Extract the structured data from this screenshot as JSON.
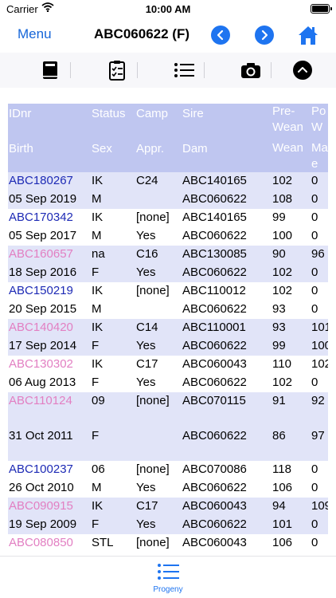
{
  "status_bar": {
    "carrier": "Carrier",
    "time": "10:00 AM"
  },
  "nav": {
    "menu_label": "Menu",
    "title": "ABC060622 (F)"
  },
  "tab_bar": {
    "label": "Progeny"
  },
  "colors": {
    "accent": "#1e74f0",
    "male_id": "#1d2ab5",
    "female_id": "#e27fc2",
    "header_bg": "#bfc6f0",
    "row_band": "#e1e4f8"
  },
  "table": {
    "header": [
      {
        "id": "IDnr",
        "status": "Status",
        "camp": "Camp",
        "sire": "Sire",
        "pre": "Pre-\nWean",
        "po": "Po\nW"
      },
      {
        "id": "Birth",
        "status": "Sex",
        "camp": "Appr.",
        "sire": "Dam",
        "pre": "Wean",
        "po": "Ma\ne"
      }
    ],
    "records": [
      {
        "gender": "male",
        "a": {
          "id": "ABC180267",
          "status": "IK",
          "camp": "C24",
          "sire": "ABC140165",
          "pre": "102",
          "po": "0"
        },
        "b": {
          "id": "05 Sep 2019",
          "status": "M",
          "camp": "",
          "sire": "ABC060622",
          "pre": "108",
          "po": "0"
        }
      },
      {
        "gender": "male",
        "a": {
          "id": "ABC170342",
          "status": "IK",
          "camp": "[none]",
          "sire": "ABC140165",
          "pre": "99",
          "po": "0"
        },
        "b": {
          "id": "05 Sep 2017",
          "status": "M",
          "camp": "Yes",
          "sire": "ABC060622",
          "pre": "100",
          "po": "0"
        }
      },
      {
        "gender": "female",
        "a": {
          "id": "ABC160657",
          "status": "na",
          "camp": "C16",
          "sire": "ABC130085",
          "pre": "90",
          "po": "96"
        },
        "b": {
          "id": "18 Sep 2016",
          "status": "F",
          "camp": "Yes",
          "sire": "ABC060622",
          "pre": "102",
          "po": "0"
        }
      },
      {
        "gender": "male",
        "a": {
          "id": "ABC150219",
          "status": "IK",
          "camp": "[none]",
          "sire": "ABC110012",
          "pre": "102",
          "po": "0"
        },
        "b": {
          "id": "20 Sep 2015",
          "status": "M",
          "camp": "",
          "sire": "ABC060622",
          "pre": "93",
          "po": "0"
        }
      },
      {
        "gender": "female",
        "a": {
          "id": "ABC140420",
          "status": "IK",
          "camp": "C14",
          "sire": "ABC110001",
          "pre": "93",
          "po": "101"
        },
        "b": {
          "id": "17 Sep 2014",
          "status": "F",
          "camp": "Yes",
          "sire": "ABC060622",
          "pre": "99",
          "po": "100"
        }
      },
      {
        "gender": "female",
        "a": {
          "id": "ABC130302",
          "status": "IK",
          "camp": "C17",
          "sire": "ABC060043",
          "pre": "110",
          "po": "102"
        },
        "b": {
          "id": "06 Aug 2013",
          "status": "F",
          "camp": "Yes",
          "sire": "ABC060622",
          "pre": "102",
          "po": "0"
        }
      },
      {
        "gender": "female",
        "a": {
          "id": "ABC110124",
          "status": "09",
          "camp": "[none]",
          "sire": "ABC070115",
          "pre": "91",
          "po": "92"
        },
        "b": {
          "id": "31 Oct 2011",
          "status": "F",
          "camp": "",
          "sire": "ABC060622",
          "pre": "86",
          "po": "97"
        }
      },
      {
        "gender": "male",
        "a": {
          "id": "ABC100237",
          "status": "06",
          "camp": "[none]",
          "sire": "ABC070086",
          "pre": "118",
          "po": "0"
        },
        "b": {
          "id": "26 Oct 2010",
          "status": "M",
          "camp": "Yes",
          "sire": "ABC060622",
          "pre": "106",
          "po": "0"
        }
      },
      {
        "gender": "female",
        "a": {
          "id": "ABC090915",
          "status": "IK",
          "camp": "C17",
          "sire": "ABC060043",
          "pre": "94",
          "po": "109"
        },
        "b": {
          "id": "19 Sep 2009",
          "status": "F",
          "camp": "Yes",
          "sire": "ABC060622",
          "pre": "101",
          "po": "0"
        }
      },
      {
        "gender": "female",
        "a": {
          "id": "ABC080850",
          "status": "STL",
          "camp": "[none]",
          "sire": "ABC060043",
          "pre": "106",
          "po": "0"
        },
        "b": {
          "id": "",
          "status": "",
          "camp": "",
          "sire": "",
          "pre": "",
          "po": ""
        }
      }
    ]
  }
}
